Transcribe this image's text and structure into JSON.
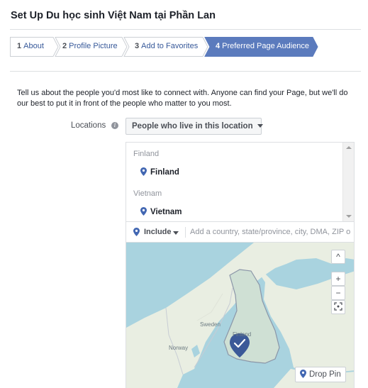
{
  "page": {
    "title": "Set Up Du học sinh Việt Nam tại Phần Lan"
  },
  "steps": [
    {
      "number": "1",
      "label": "About"
    },
    {
      "number": "2",
      "label": "Profile Picture"
    },
    {
      "number": "3",
      "label": "Add to Favorites"
    },
    {
      "number": "4",
      "label": "Preferred Page Audience"
    }
  ],
  "active_step": 4,
  "intro": "Tell us about the people you'd most like to connect with. Anyone can find your Page, but we'll do our best to put it in front of the people who matter to you most.",
  "locations": {
    "label": "Locations",
    "info_icon": "info-icon",
    "dropdown_value": "People who live in this location",
    "groups": [
      {
        "heading": "Finland",
        "item": "Finland"
      },
      {
        "heading": "Vietnam",
        "item": "Vietnam"
      }
    ],
    "include_label": "Include",
    "search_placeholder": "Add a country, state/province, city, DMA, ZIP o"
  },
  "map": {
    "labels": {
      "sweden": "Sweden",
      "norway": "Norway",
      "finland": "Finland"
    },
    "controls": {
      "collapse": "^",
      "zoom_in": "+",
      "zoom_out": "−"
    },
    "drop_pin_label": "Drop Pin"
  },
  "colors": {
    "link": "#365899",
    "active_step_bg": "#5b7bbd",
    "pin": "#4267b2",
    "map_water": "#a9d3df",
    "map_land": "#e9eee2",
    "map_highlight": "#cfe0d4"
  }
}
